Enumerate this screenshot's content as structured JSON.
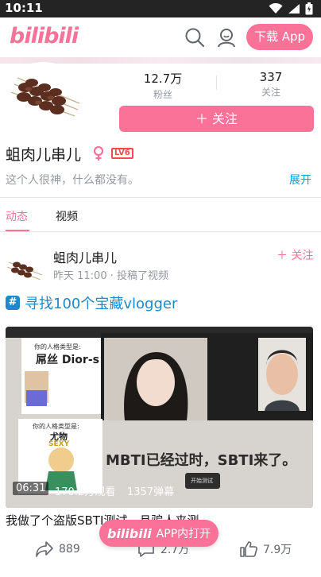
{
  "status_bar": {
    "time": "10:11",
    "icons": [
      "wifi-icon",
      "signal-icon",
      "battery-icon"
    ]
  },
  "header": {
    "logo": "bilibili",
    "download_button": "下载 App",
    "icons": [
      "search-icon",
      "user-icon"
    ]
  },
  "profile": {
    "stats": [
      {
        "value": "12.7万",
        "label": "粉丝"
      },
      {
        "value": "337",
        "label": "关注"
      }
    ],
    "follow_button": "＋ 关注",
    "name": "蛆肉儿串儿",
    "level": "LV6",
    "bio": "这个人很神，什么都没有。",
    "expand": "展开"
  },
  "tabs": [
    {
      "label": "动态",
      "active": true
    },
    {
      "label": "视频",
      "active": false
    }
  ],
  "post": {
    "author": "蛆肉儿串儿",
    "meta": "昨天 11:00 · 投稿了视频",
    "follow": "＋ 关注",
    "topic_badge": "#",
    "topic": "寻找100个宝藏vlogger",
    "video": {
      "duration": "06:31",
      "views": "170.2万观看",
      "danmaku": "1357弹幕",
      "thumb_texts": {
        "card1_small": "你的人格类型是:",
        "card1_big": "屌丝 Dior-s",
        "card2_small": "你的人格类型是:",
        "card2_big": "尤物",
        "card2_sub": "SEXY",
        "subtitle": "MBTI已经过时，SBTI来了。",
        "button": "开始测试"
      }
    },
    "caption": "我做了个盗版SBTI测试，且骗人来测。",
    "actions": [
      {
        "icon": "share-icon",
        "count": "889"
      },
      {
        "icon": "comment-icon",
        "count": "2.7万"
      },
      {
        "icon": "like-icon",
        "count": "7.9万"
      }
    ]
  },
  "floating": {
    "logo": "bilibili",
    "label": "APP内打开"
  },
  "colors": {
    "accent": "#fb7299",
    "link": "#1e88c8",
    "muted": "#9499a0",
    "level": "#f04c49"
  }
}
